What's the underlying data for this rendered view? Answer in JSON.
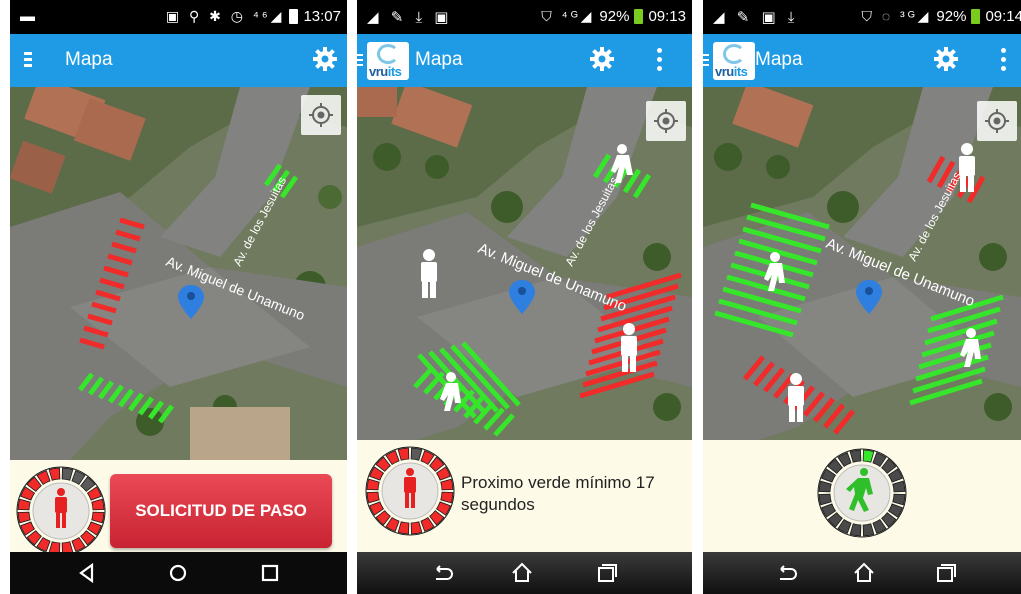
{
  "screens": [
    {
      "status": {
        "left_icons": "▬",
        "right_icons": "▣ ⚲ ✱ ◷ ⁴⁶◢",
        "time": "13:07"
      },
      "appbar": {
        "title": "Mapa"
      },
      "map": {
        "street_main": "Av. Miguel de Unamuno",
        "street_side": "Av. de los Jesuitas"
      },
      "action": {
        "button_label": "SOLICITUD DE PASO"
      }
    },
    {
      "status": {
        "left_icons": "◢ ✎ ⤓ ▣",
        "right_icons": "⛉ ⁴ᴳ◢",
        "battery_pct": "92%",
        "time": "09:13"
      },
      "appbar": {
        "title": "Mapa"
      },
      "logo": {
        "text_a": "vru",
        "text_b": "its"
      },
      "map": {
        "street_main": "Av. Miguel de Unamuno",
        "street_side": "Av. de los Jesuitas"
      },
      "info": {
        "message": "Proximo verde mínimo 17 segundos"
      }
    },
    {
      "status": {
        "left_icons": "◢ ✎ ▣ ⤓",
        "right_icons": "⛉ ◌ ³ᴳ◢",
        "battery_pct": "92%",
        "time": "09:14"
      },
      "appbar": {
        "title": "Mapa"
      },
      "logo": {
        "text_a": "vru",
        "text_b": "its"
      },
      "map": {
        "street_main": "Av. Miguel de Unamuno",
        "street_side": "Av. de los Jesuitas"
      }
    }
  ],
  "colors": {
    "appbar": "#1e9be4",
    "crosswalk_red": "#f12a2a",
    "crosswalk_green": "#35e62a",
    "panel_bg": "#fdfbe8",
    "button_red": "#d3303d",
    "marker_blue": "#2f7fe0"
  },
  "icons": [
    "menu-icon",
    "gear-icon",
    "more-icon",
    "locate-icon",
    "location-marker-icon",
    "pedestrian-icon",
    "back-icon",
    "home-icon",
    "recents-icon"
  ],
  "timers": {
    "screen1_remaining_fraction": 0.83,
    "screen2_remaining_fraction": 0.95,
    "screen3_elapsed_fraction": 0.05
  }
}
